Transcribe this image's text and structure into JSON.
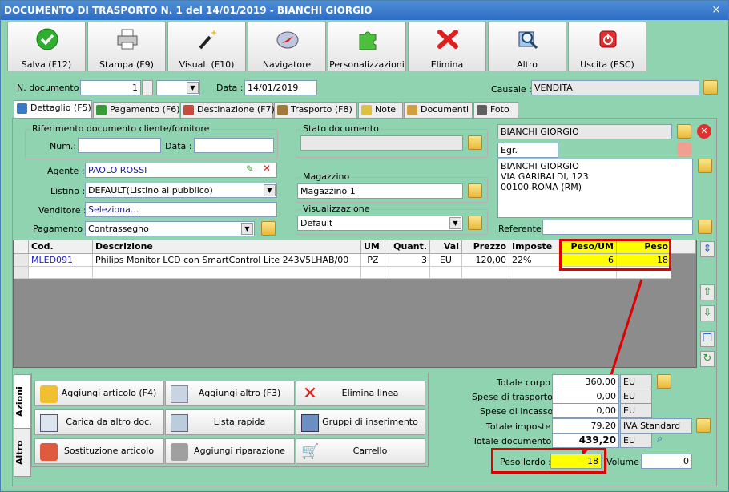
{
  "window": {
    "title": "DOCUMENTO DI TRASPORTO N. 1 del 14/01/2019 - BIANCHI GIORGIO",
    "close": "×"
  },
  "toolbar": [
    {
      "label": "Salva (F12)",
      "icon": "check-icon"
    },
    {
      "label": "Stampa (F9)",
      "icon": "printer-icon"
    },
    {
      "label": "Visual. (F10)",
      "icon": "magic-wand-icon"
    },
    {
      "label": "Navigatore",
      "icon": "compass-icon"
    },
    {
      "label": "Personalizzazioni",
      "icon": "puzzle-icon"
    },
    {
      "label": "Elimina",
      "icon": "delete-x-icon"
    },
    {
      "label": "Altro",
      "icon": "magnifier-icon"
    },
    {
      "label": "Uscita (ESC)",
      "icon": "power-icon"
    }
  ],
  "header": {
    "ndoc_label": "N. documento :",
    "ndoc_value": "1",
    "data_label": "Data :",
    "data_value": "14/01/2019",
    "causale_label": "Causale :",
    "causale_value": "VENDITA"
  },
  "tabs": [
    {
      "label": "Dettaglio (F5)",
      "color": "#3a78c8"
    },
    {
      "label": "Pagamento (F6)",
      "color": "#3a9a3a"
    },
    {
      "label": "Destinazione (F7)",
      "color": "#c84a3a"
    },
    {
      "label": "Trasporto (F8)",
      "color": "#a07a3a"
    },
    {
      "label": "Note",
      "color": "#e0c040"
    },
    {
      "label": "Documenti",
      "color": "#d0a040"
    },
    {
      "label": "Foto",
      "color": "#606060"
    }
  ],
  "rif": {
    "title": "Riferimento documento cliente/fornitore",
    "num_label": "Num.:",
    "data_label": "Data :"
  },
  "agente": {
    "label": "Agente :",
    "value": "PAOLO ROSSI"
  },
  "listino": {
    "label": "Listino :",
    "value": "DEFAULT(Listino al pubblico)"
  },
  "venditore": {
    "label": "Venditore :",
    "value": "Seleziona..."
  },
  "pagamento": {
    "label": "Pagamento :",
    "value": "Contrassegno"
  },
  "stato": {
    "title": "Stato documento"
  },
  "magazzino": {
    "title": "Magazzino",
    "value": "Magazzino 1"
  },
  "visualizzazione": {
    "title": "Visualizzazione",
    "value": "Default"
  },
  "cliente": {
    "name": "BIANCHI GIORGIO",
    "title": "Egr.",
    "address": [
      "BIANCHI GIORGIO",
      "VIA GARIBALDI, 123",
      "00100 ROMA (RM)"
    ],
    "referente_label": "Referente"
  },
  "grid": {
    "columns": [
      "Cod.",
      "Descrizione",
      "UM",
      "Quant.",
      "Val",
      "Prezzo",
      "Imposte",
      "Peso/UM",
      "Peso"
    ],
    "rows": [
      {
        "cod": "MLED091",
        "desc": "Philips Monitor LCD con SmartControl Lite 243V5LHAB/00",
        "um": "PZ",
        "quant": "3",
        "val": "EU",
        "prezzo": "120,00",
        "imposte": "22%",
        "pesoum": "6",
        "peso": "18"
      }
    ]
  },
  "side_tabs": {
    "azioni": "Azioni",
    "altro": "Altro"
  },
  "actions": [
    {
      "label": "Aggiungi articolo (F4)",
      "icon": "add-article-icon"
    },
    {
      "label": "Aggiungi altro (F3)",
      "icon": "add-other-icon"
    },
    {
      "label": "Elimina linea",
      "icon": "delete-line-icon"
    },
    {
      "label": "Carica da altro doc.",
      "icon": "load-doc-icon"
    },
    {
      "label": "Lista rapida",
      "icon": "quick-list-icon"
    },
    {
      "label": "Gruppi di inserimento",
      "icon": "groups-icon"
    },
    {
      "label": "Sostituzione articolo",
      "icon": "replace-icon"
    },
    {
      "label": "Aggiungi riparazione",
      "icon": "repair-icon"
    },
    {
      "label": "Carrello",
      "icon": "cart-icon"
    }
  ],
  "totals": {
    "corpo_label": "Totale corpo :",
    "corpo": "360,00",
    "corpo_cur": "EU",
    "trasporto_label": "Spese di trasporto :",
    "trasporto": "0,00",
    "trasporto_cur": "EU",
    "incasso_label": "Spese di incasso :",
    "incasso": "0,00",
    "incasso_cur": "EU",
    "imposte_label": "Totale imposte :",
    "imposte": "79,20",
    "imposte_type": "IVA Standard",
    "documento_label": "Totale documento :",
    "documento": "439,20",
    "documento_cur": "EU",
    "peso_label": "Peso lordo :",
    "peso": "18",
    "volume_label": "Volume :",
    "volume": "0"
  },
  "colors": {
    "accent_red": "#e00000",
    "highlight": "#ffff00",
    "bg": "#8fd3b0"
  }
}
